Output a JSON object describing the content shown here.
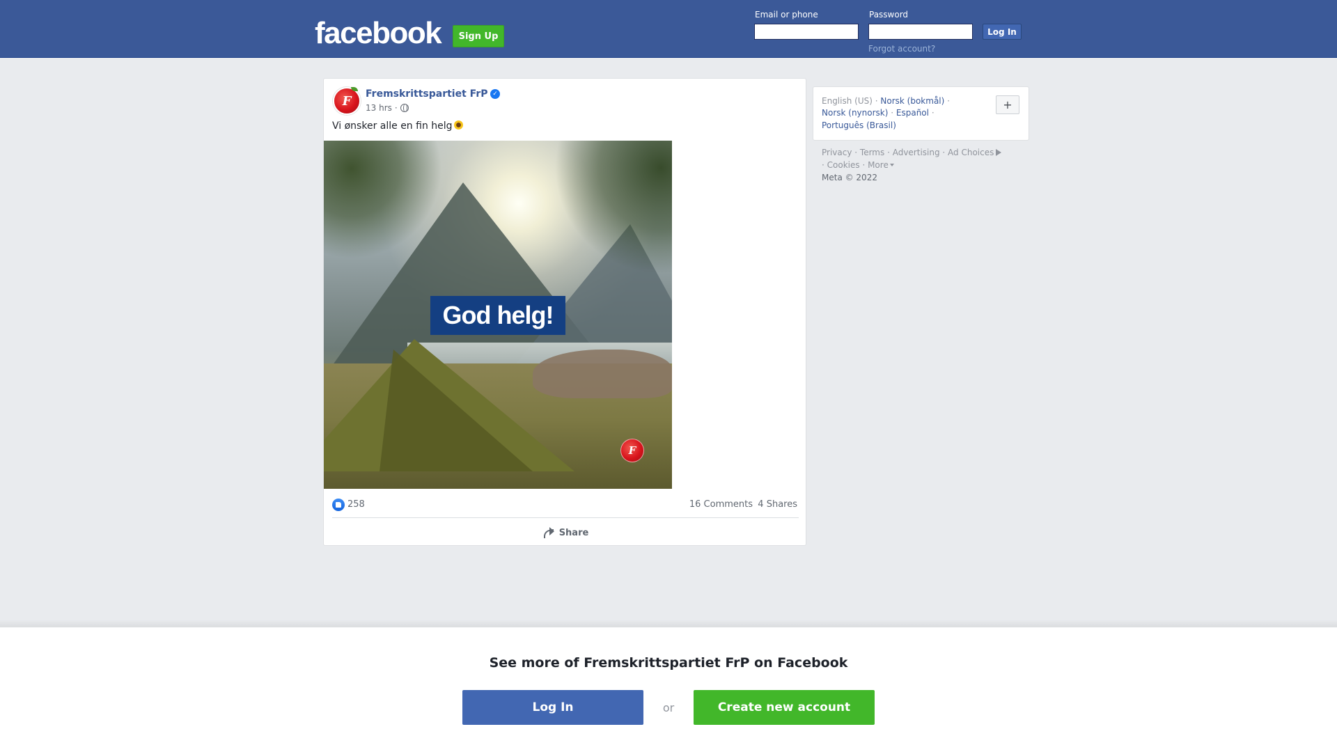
{
  "header": {
    "logo_text": "facebook",
    "signup_label": "Sign Up",
    "email_label": "Email or phone",
    "email_value": "",
    "password_label": "Password",
    "password_value": "",
    "login_label": "Log In",
    "forgot_label": "Forgot account?"
  },
  "post": {
    "avatar_letter": "F",
    "page_name": "Fremskrittspartiet FrP",
    "verified": true,
    "time": "13 hrs",
    "separator": "·",
    "audience_icon": "globe-icon",
    "text": "Vi ønsker alle en fin helg",
    "text_emoji_icon": "sunflower-icon",
    "image_caption": "God helg!",
    "image_logo_letter": "F",
    "like_count": "258",
    "comments": "16 Comments",
    "shares": "4 Shares",
    "share_label": "Share"
  },
  "languages": {
    "current": "English (US)",
    "links": [
      "Norsk (bokmål)",
      "Norsk (nynorsk)",
      "Español",
      "Português (Brasil)"
    ],
    "plus_label": "+"
  },
  "footer": {
    "links": [
      "Privacy",
      "Terms",
      "Advertising",
      "Ad Choices",
      "Cookies",
      "More"
    ],
    "copyright": "Meta © 2022"
  },
  "banner": {
    "title": "See more of Fremskrittspartiet FrP on Facebook",
    "login_label": "Log In",
    "or_label": "or",
    "create_label": "Create new account"
  },
  "colors": {
    "brand_blue": "#3b5998",
    "button_blue": "#4267b2",
    "green": "#42b72a",
    "link": "#385898",
    "background": "#e9ebee"
  }
}
